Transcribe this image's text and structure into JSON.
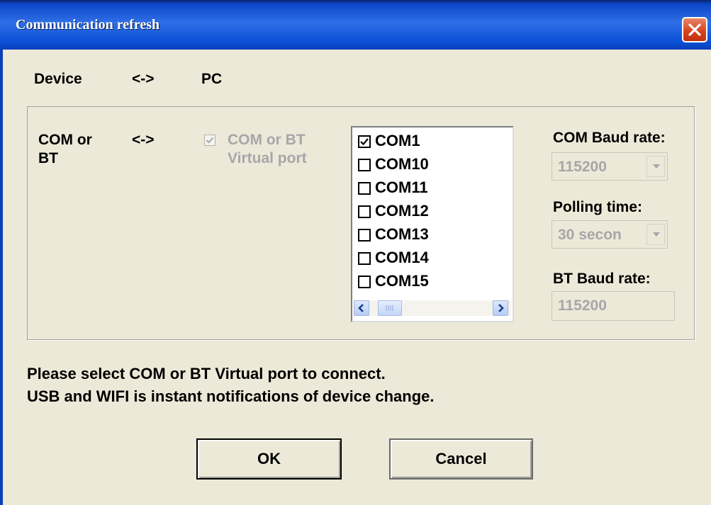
{
  "window": {
    "title": "Communication refresh"
  },
  "header": {
    "device": "Device",
    "arrow": "<->",
    "pc": "PC"
  },
  "group": {
    "left_label_line1": "COM or",
    "left_label_line2": "BT",
    "arrow": "<->",
    "virtual_port_line1": "COM or BT",
    "virtual_port_line2": "Virtual port",
    "virtual_port_checked": true,
    "virtual_port_enabled": false,
    "ports": [
      {
        "label": "COM1",
        "checked": true
      },
      {
        "label": "COM10",
        "checked": false
      },
      {
        "label": "COM11",
        "checked": false
      },
      {
        "label": "COM12",
        "checked": false
      },
      {
        "label": "COM13",
        "checked": false
      },
      {
        "label": "COM14",
        "checked": false
      },
      {
        "label": "COM15",
        "checked": false
      }
    ],
    "com_baud": {
      "label": "COM Baud rate:",
      "value": "115200"
    },
    "polling": {
      "label": "Polling time:",
      "value": "30 secon"
    },
    "bt_baud": {
      "label": "BT Baud rate:",
      "value": "115200"
    }
  },
  "message": {
    "line1": "Please select COM or BT Virtual port to connect.",
    "line2": "USB and WIFI is instant notifications of device change."
  },
  "buttons": {
    "ok": "OK",
    "cancel": "Cancel"
  },
  "colors": {
    "title_bar": "#0a4fd6",
    "face": "#ece9d8",
    "disabled_text": "#a7a6aa",
    "close_button": "#d84520"
  },
  "icons": {
    "close": "close-x-icon",
    "scroll_left": "arrow-left-icon",
    "scroll_right": "arrow-right-icon",
    "dropdown": "chevron-down-icon"
  }
}
